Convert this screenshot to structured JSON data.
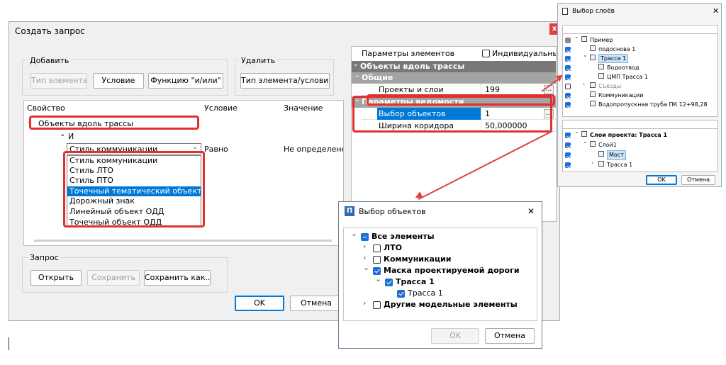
{
  "main_dialog": {
    "title": "Создать запрос",
    "close_glyph": "x",
    "add_group": {
      "label": "Добавить",
      "element_type_button": "Тип элемента",
      "condition_button": "Условие",
      "function_button": "Функцию \"и/или\""
    },
    "delete_group": {
      "label": "Удалить",
      "button": "Тип элемента/условие"
    },
    "query_table": {
      "columns": [
        "Свойство",
        "Условие",
        "Значение"
      ],
      "root_row": "Объекты вдоль трассы",
      "and_row": "И",
      "selected_property": "Стиль коммуникации",
      "condition_value": "Равно",
      "value_value": "Не определено",
      "dropdown_options": [
        "Стиль коммуникации",
        "Стиль ЛТО",
        "Стиль ПТО",
        "Точечный тематический объект",
        "Дорожный знак",
        "Линейный объект ОДД",
        "Точечный объект ОДД"
      ],
      "highlighted_option": "Точечный тематический объект"
    },
    "request_group": {
      "label": "Запрос",
      "open_button": "Открыть",
      "save_button": "Сохранить",
      "save_as_button": "Сохранить как..."
    },
    "ok_button": "OK",
    "cancel_button": "Отмена"
  },
  "property_grid": {
    "header_left": "Параметры элементов",
    "header_checkbox_label": "Индивидуальны",
    "section_title": "Объекты вдоль трассы",
    "subsection_general": "Общие",
    "projects_layers_label": "Проекты и слои",
    "projects_layers_value": "199",
    "subsection_params": "Параметры ведомости",
    "objects_label": "Выбор объектов",
    "objects_value": "1",
    "corridor_label": "Ширина коридора",
    "corridor_value": "50,000000",
    "ellipsis": "..."
  },
  "layers_dialog": {
    "title": "Выбор слоёв",
    "close_glyph": "✕",
    "top_tree": [
      {
        "label": "Пример",
        "level": 0,
        "check": "grey",
        "expanded": true
      },
      {
        "label": "подоснова 1",
        "level": 1,
        "check": "on"
      },
      {
        "label": "Трасса 1",
        "level": 1,
        "check": "on",
        "expanded": true,
        "selected": true
      },
      {
        "label": "Водоотвод",
        "level": 2,
        "check": "on"
      },
      {
        "label": "ЦМП Трасса 1",
        "level": 2,
        "check": "on"
      },
      {
        "label": "Съезды",
        "level": 1,
        "check": "empty",
        "collapsed": true,
        "muted": true
      },
      {
        "label": "Коммуникации",
        "level": 1,
        "check": "on"
      },
      {
        "label": "Водопропускная труба ПК 12+98,28",
        "level": 1,
        "check": "on"
      }
    ],
    "bottom_tree": [
      {
        "label": "Слои проекта: Трасса 1",
        "level": 0,
        "check": "on",
        "expanded": true,
        "bold": true
      },
      {
        "label": "Слой1",
        "level": 1,
        "check": "on",
        "expanded": true
      },
      {
        "label": "Мост",
        "level": 2,
        "check": "on",
        "selected": true
      },
      {
        "label": "Трасса 1",
        "level": 2,
        "check": "on",
        "collapsed": true
      }
    ],
    "ok_button": "OK",
    "cancel_button": "Отмена"
  },
  "objects_dialog": {
    "title": "Выбор объектов",
    "app_icon_letter": "П",
    "close_glyph": "✕",
    "tree": [
      {
        "label": "Все элементы",
        "level": 0,
        "check": "ind",
        "expanded": true
      },
      {
        "label": "ЛТО",
        "level": 1,
        "check": "empty",
        "collapsed": true
      },
      {
        "label": "Коммуникации",
        "level": 1,
        "check": "empty",
        "collapsed": true
      },
      {
        "label": "Маска проектируемой дороги",
        "level": 1,
        "check": "on",
        "expanded": true
      },
      {
        "label": "Трасса 1",
        "level": 2,
        "check": "on",
        "expanded": true
      },
      {
        "label": "Трасса 1",
        "level": 3,
        "check": "on",
        "leaf": true
      },
      {
        "label": "Другие модельные элементы",
        "level": 1,
        "check": "empty",
        "collapsed": true
      }
    ],
    "ok_button": "OK",
    "cancel_button": "Отмена"
  },
  "colors": {
    "highlight_red": "#e03030",
    "selection_blue": "#0078d7",
    "grid_header_grey": "#787878"
  }
}
